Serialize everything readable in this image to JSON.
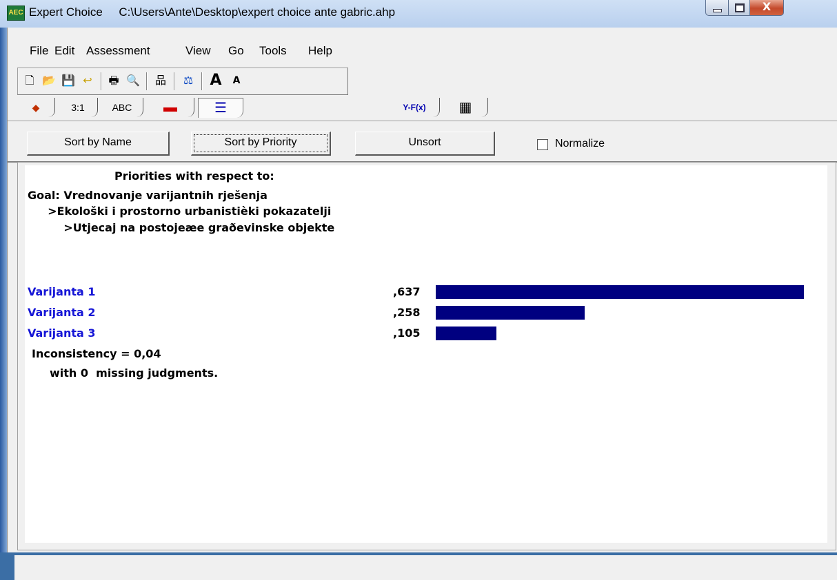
{
  "window": {
    "app_icon": "AEC",
    "title": "Expert Choice     C:\\Users\\Ante\\Desktop\\expert choice ante gabric.ahp",
    "close_glyph": "X"
  },
  "menu": [
    "File",
    "Edit",
    "Assessment",
    "View",
    "Go",
    "Tools",
    "Help"
  ],
  "toolbar": {
    "icons": [
      "new-document-icon",
      "open-folder-icon",
      "save-disk-icon",
      "undo-icon",
      "print-icon",
      "print-preview-icon",
      "hierarchy-icon",
      "balance-scale-icon",
      "font-larger-icon",
      "font-smaller-icon"
    ],
    "glyphs": {
      "new": "🗋",
      "open": "📂",
      "save": "💾",
      "undo": "↩",
      "print": "🖶",
      "preview": "🔍",
      "hierarchy": "品",
      "scale": "⚖",
      "font_up": "A",
      "font_down": "A"
    }
  },
  "tabs": [
    {
      "name": "tab-graphical",
      "glyph": "◆"
    },
    {
      "name": "tab-numerical",
      "label": "3:1"
    },
    {
      "name": "tab-verbal",
      "label": "ABC"
    },
    {
      "name": "tab-questionnaire",
      "glyph": "▬"
    },
    {
      "name": "tab-priorities",
      "glyph": "☰"
    },
    {
      "name": "tab-formula",
      "label": "Y-F(x)"
    },
    {
      "name": "tab-grid",
      "glyph": "▦"
    }
  ],
  "sort_bar": {
    "sort_by_name": "Sort by Name",
    "sort_by_priority": "Sort by Priority",
    "unsort": "Unsort",
    "normalize": "Normalize"
  },
  "report": {
    "header": "Priorities with respect to:",
    "goal": "Goal: Vrednovanje varijantnih rješenja",
    "path_1": "  >Ekološki i prostorno urbanistièki pokazatelji",
    "path_2": "    >Utjecaj na postojeæe graðevinske objekte",
    "alternatives": [
      {
        "name": "Varijanta 1",
        "value_label": ",637",
        "value": 0.637
      },
      {
        "name": "Varijanta 2",
        "value_label": ",258",
        "value": 0.258
      },
      {
        "name": "Varijanta 3",
        "value_label": ",105",
        "value": 0.105
      }
    ],
    "inconsistency": "Inconsistency = 0,04",
    "missing": "with 0  missing judgments.",
    "bar_color": "#000080",
    "name_color": "#1515d6"
  }
}
